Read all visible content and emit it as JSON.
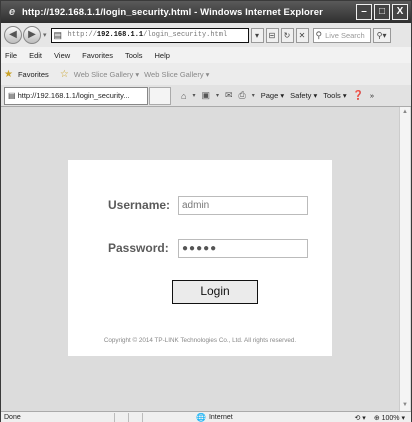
{
  "window": {
    "title": "http://192.168.1.1/login_security.html - Windows Internet Explorer",
    "minimize": "–",
    "maximize": "□",
    "close": "X"
  },
  "address": {
    "url_prefix": "http://",
    "url_host": "192.168.1.1",
    "url_path": "/login_security.html",
    "search_placeholder": "Live Search"
  },
  "menu": [
    "File",
    "Edit",
    "View",
    "Favorites",
    "Tools",
    "Help"
  ],
  "favorites": {
    "label": "Favorites",
    "links": [
      "Web Slice Gallery ▾",
      "Web Slice Gallery ▾"
    ]
  },
  "tab": {
    "label": "http://192.168.1.1/login_security..."
  },
  "commands": {
    "page": "Page",
    "safety": "Safety",
    "tools": "Tools"
  },
  "login": {
    "username_label": "Username:",
    "username_value": "admin",
    "password_label": "Password:",
    "password_value": "●●●●●",
    "button_label": "Login",
    "copyright": "Copyright © 2014 TP-LINK Technologies Co., Ltd. All rights reserved."
  },
  "status": {
    "text": "Done",
    "zone": "Internet",
    "zoom": "100%"
  },
  "colors": {
    "titlebar": "#2f2f2f",
    "page_background": "#dcdcdc",
    "card": "#ffffff"
  }
}
